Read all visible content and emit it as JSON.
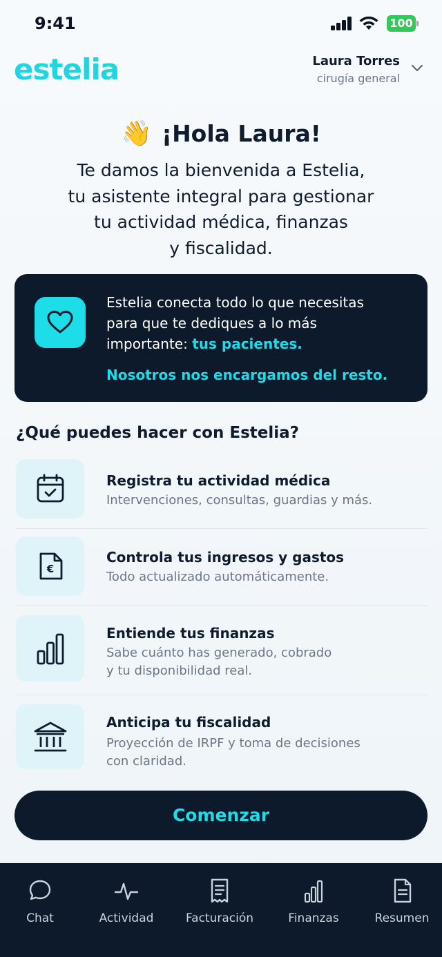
{
  "status_bar": {
    "time": "9:41",
    "battery": "100"
  },
  "header": {
    "logo": "estelia",
    "user_name": "Laura Torres",
    "user_role": "cirugía general"
  },
  "greeting": {
    "emoji": "👋",
    "title": "¡Hola Laura!",
    "intro_lines": [
      "Te damos la bienvenida a Estelia,",
      "tu asistente integral para gestionar",
      "tu actividad médica, finanzas",
      "y fiscalidad."
    ]
  },
  "promo_card": {
    "text_line1": "Estelia conecta todo lo que necesitas",
    "text_line2": "para que te dediques a lo más",
    "text_line3_prefix": "importante: ",
    "text_line3_accent": "tus pacientes.",
    "cta": "Nosotros nos encargamos del resto."
  },
  "features_section": {
    "title": "¿Qué puedes hacer con Estelia?",
    "items": [
      {
        "icon": "calendar-check-icon",
        "title": "Registra tu actividad médica",
        "desc_lines": [
          "Intervenciones, consultas, guardias y más."
        ]
      },
      {
        "icon": "euro-document-icon",
        "title": "Controla tus ingresos y gastos",
        "desc_lines": [
          "Todo actualizado automáticamente."
        ]
      },
      {
        "icon": "bar-chart-icon",
        "title": "Entiende tus finanzas",
        "desc_lines": [
          "Sabe cuánto has generado, cobrado",
          "y tu disponibilidad real."
        ]
      },
      {
        "icon": "bank-icon",
        "title": "Anticipa tu fiscalidad",
        "desc_lines": [
          "Proyección de IRPF y toma de decisiones",
          "con claridad."
        ]
      }
    ]
  },
  "start_button": {
    "label": "Comenzar"
  },
  "tab_bar": {
    "tabs": [
      {
        "label": "Chat",
        "icon": "chat-bubble-icon"
      },
      {
        "label": "Actividad",
        "icon": "pulse-icon"
      },
      {
        "label": "Facturación",
        "icon": "receipt-icon"
      },
      {
        "label": "Finanzas",
        "icon": "bar-chart-icon"
      },
      {
        "label": "Resumen",
        "icon": "document-icon"
      }
    ]
  },
  "colors": {
    "accent": "#1ddde8",
    "dark": "#0c1a2b",
    "text": "#0f1c2e",
    "muted": "#6b7787",
    "icon_bg": "#dff4f8",
    "battery": "#34c759"
  }
}
